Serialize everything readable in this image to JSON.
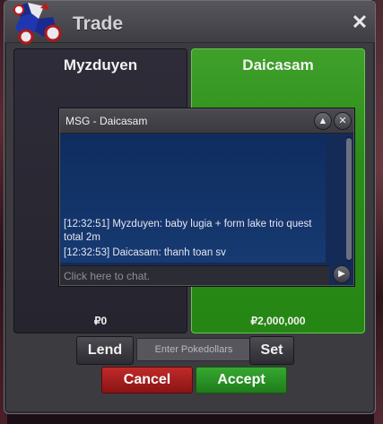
{
  "window": {
    "title": "Trade",
    "close_symbol": "✕"
  },
  "left_panel": {
    "player_name": "Myzduyen",
    "amount": "₽0"
  },
  "right_panel": {
    "player_name": "Daicasam",
    "amount": "₽2,000,000"
  },
  "chat": {
    "title": "MSG - Daicasam",
    "messages": [
      "[12:32:51] Myzduyen: baby lugia + form lake trio quest total 2m",
      "[12:32:53] Daicasam: thanh toan sv"
    ],
    "input_placeholder": "Click here to chat.",
    "minimize_symbol": "▲",
    "close_symbol": "✕",
    "send_symbol": "▶"
  },
  "controls": {
    "lend_label": "Lend",
    "pokedollar_placeholder": "Enter Pokedollars",
    "set_label": "Set",
    "cancel_label": "Cancel",
    "accept_label": "Accept"
  },
  "colors": {
    "window_bg": "#3b3b40",
    "ready_green": "#2b8c1a",
    "chat_blue": "#142b57",
    "cancel_red": "#a01e1e",
    "accept_green": "#2a9424"
  }
}
